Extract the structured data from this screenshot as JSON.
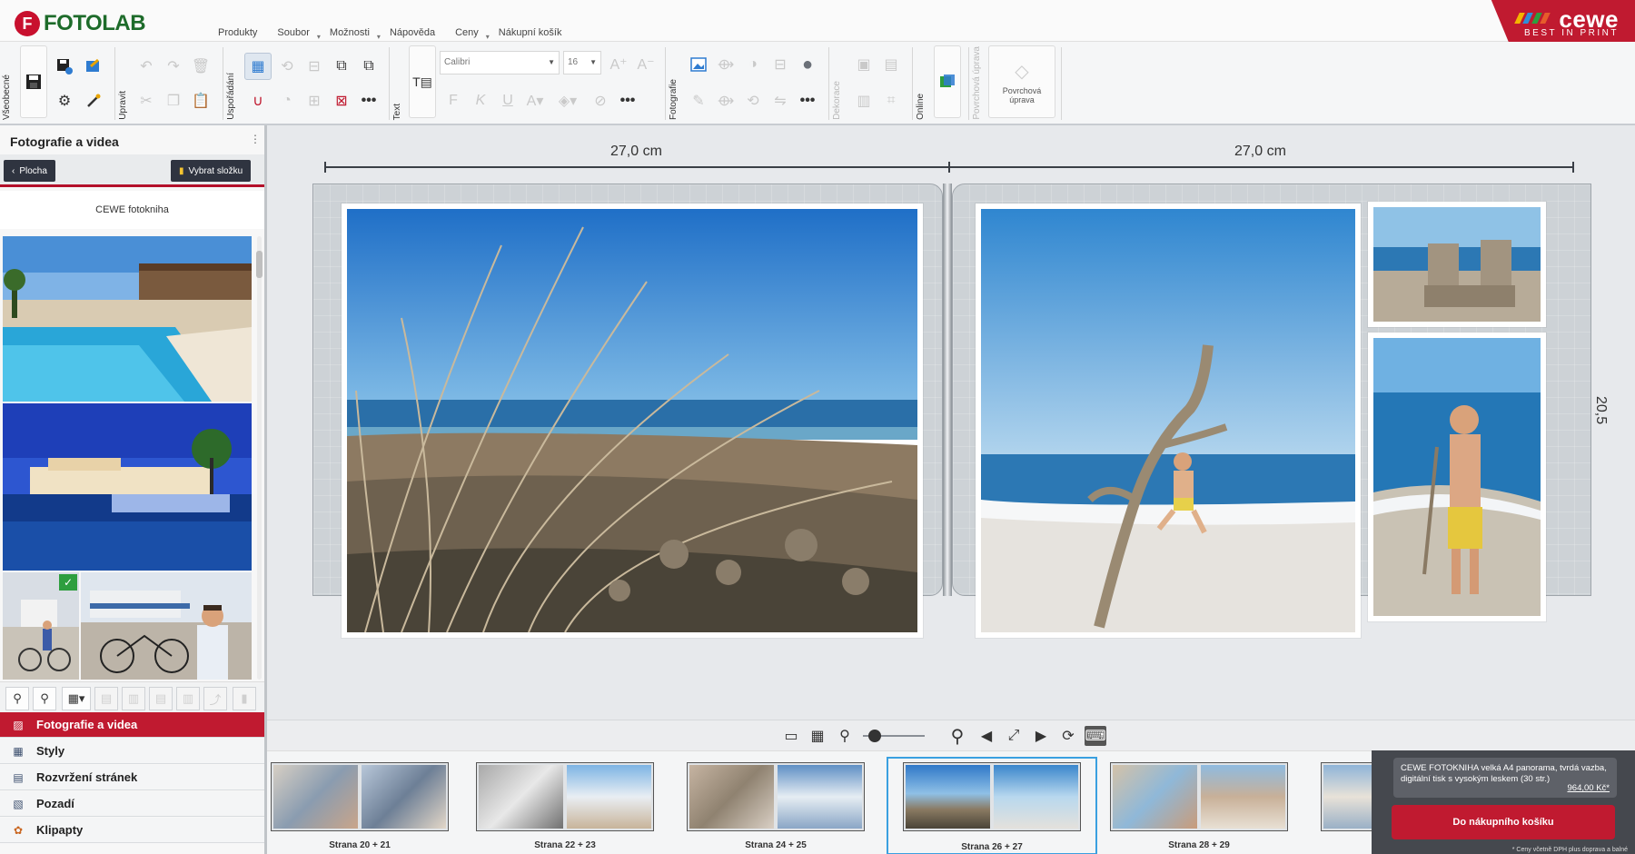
{
  "app": {
    "logo_text": "FOTOLAB",
    "logo_letter": "F"
  },
  "menu": [
    {
      "label": "Produkty",
      "caret": false
    },
    {
      "label": "Soubor",
      "caret": true
    },
    {
      "label": "Možnosti",
      "caret": true
    },
    {
      "label": "Nápověda",
      "caret": false
    },
    {
      "label": "Ceny",
      "caret": true
    },
    {
      "label": "Nákupní košík",
      "caret": false
    }
  ],
  "brand": {
    "name": "cewe",
    "tagline": "BEST IN PRINT",
    "stripe_colors": [
      "#f4b400",
      "#2f8fd8",
      "#2e9e3f",
      "#e65c2b"
    ]
  },
  "ribbon": {
    "groups": {
      "general": "Všeobecné",
      "edit": "Upravit",
      "arrange": "Uspořádání",
      "text": "Text",
      "photo": "Fotografie",
      "decoration": "Dekorace",
      "online": "Online",
      "surface_group": "Povrchová úprava"
    },
    "font_name": "Calibri",
    "font_size": "16",
    "surface_button": "Povrchová úprava"
  },
  "left_panel": {
    "title": "Fotografie a videa",
    "back_button": "Plocha",
    "folder_button": "Vybrat složku",
    "folder_name": "CEWE fotokniha",
    "categories": [
      {
        "label": "Fotografie a videa",
        "icon": "photo-icon",
        "active": true
      },
      {
        "label": "Styly",
        "icon": "styles-icon",
        "active": false
      },
      {
        "label": "Rozvržení stránek",
        "icon": "layout-icon",
        "active": false
      },
      {
        "label": "Pozadí",
        "icon": "background-icon",
        "active": false
      },
      {
        "label": "Klipарty",
        "icon": "clipart-icon",
        "active": false
      }
    ]
  },
  "workspace": {
    "width_left": "27,0 cm",
    "width_right": "27,0 cm",
    "height": "20,5 cm"
  },
  "filmstrip": [
    {
      "label": "Strana 20 + 21",
      "current": false
    },
    {
      "label": "Strana 22 + 23",
      "current": false
    },
    {
      "label": "Strana 24 + 25",
      "current": false
    },
    {
      "label": "Strana 26 + 27",
      "current": true
    },
    {
      "label": "Strana 28 + 29",
      "current": false
    }
  ],
  "cart": {
    "description": "CEWE FOTOKNIHA velká A4 panorama, tvrdá vazba, digitální tisk s vysokým leskem (30 str.)",
    "price": "964,00 Kč*",
    "button": "Do nákupního košíku",
    "note": "* Ceny včetně DPH plus doprava a balné"
  },
  "colors": {
    "accent_red": "#c01a30",
    "dark_button": "#2f3440",
    "selection_blue": "#3aa0e0"
  }
}
